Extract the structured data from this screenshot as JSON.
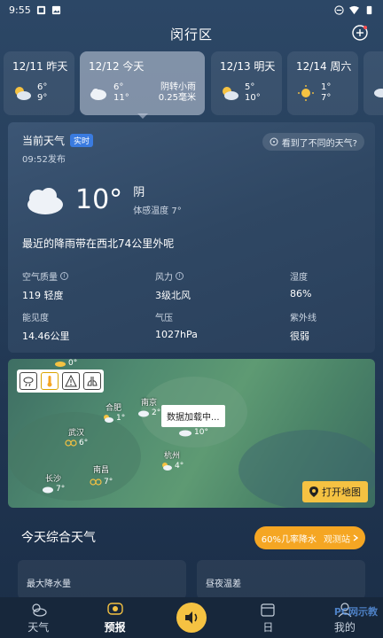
{
  "status_bar": {
    "time": "9:55"
  },
  "header": {
    "title": "闵行区"
  },
  "days": [
    {
      "date": "12/11 昨天",
      "high": "6°",
      "low": "9°",
      "desc": ""
    },
    {
      "date": "12/12 今天",
      "high": "6°",
      "low": "11°",
      "desc": "阴转小雨",
      "desc2": "0.25毫米"
    },
    {
      "date": "12/13 明天",
      "high": "5°",
      "low": "10°",
      "desc": ""
    },
    {
      "date": "12/14 周六",
      "high": "1°",
      "low": "7°",
      "desc": ""
    }
  ],
  "current": {
    "title": "当前天气",
    "badge": "实时",
    "feedback": "看到了不同的天气?",
    "publish_time": "09:52发布",
    "temp": "10°",
    "condition": "阴",
    "feels_like": "体感温度 7°",
    "rain_notice": "最近的降雨带在西北74公里外呢",
    "stats": {
      "aqi_label": "空气质量",
      "aqi_value": "119 轻度",
      "wind_label": "风力",
      "wind_value": "3级北风",
      "humidity_label": "湿度",
      "humidity_value": "86%",
      "visibility_label": "能见度",
      "visibility_value": "14.46公里",
      "pressure_label": "气压",
      "pressure_value": "1027hPa",
      "uv_label": "紫外线",
      "uv_value": "很弱"
    }
  },
  "map": {
    "loading": "数据加载中...",
    "open_map": "打开地图",
    "cities": {
      "hefei": "合肥",
      "nanjing": "南京",
      "wuhan": "武汉",
      "hangzhou": "杭州",
      "nanchang": "南昌",
      "changsha": "长沙"
    },
    "temps": {
      "top": "0°",
      "hefei": "1°",
      "nanjing": "2°",
      "wuhan": "6°",
      "shanghai": "10°",
      "hangzhou": "4°",
      "nanchang": "7°",
      "changsha": "7°"
    }
  },
  "today": {
    "title": "今天综合天气",
    "rain_chance": "60%几率降水",
    "station": "观测站"
  },
  "cards": {
    "max_rain": "最大降水量",
    "day_night_diff": "昼夜温差"
  },
  "nav": {
    "weather": "天气",
    "forecast": "预报",
    "calendar": "日",
    "mine": "我的"
  },
  "watermark": "PC网示教"
}
